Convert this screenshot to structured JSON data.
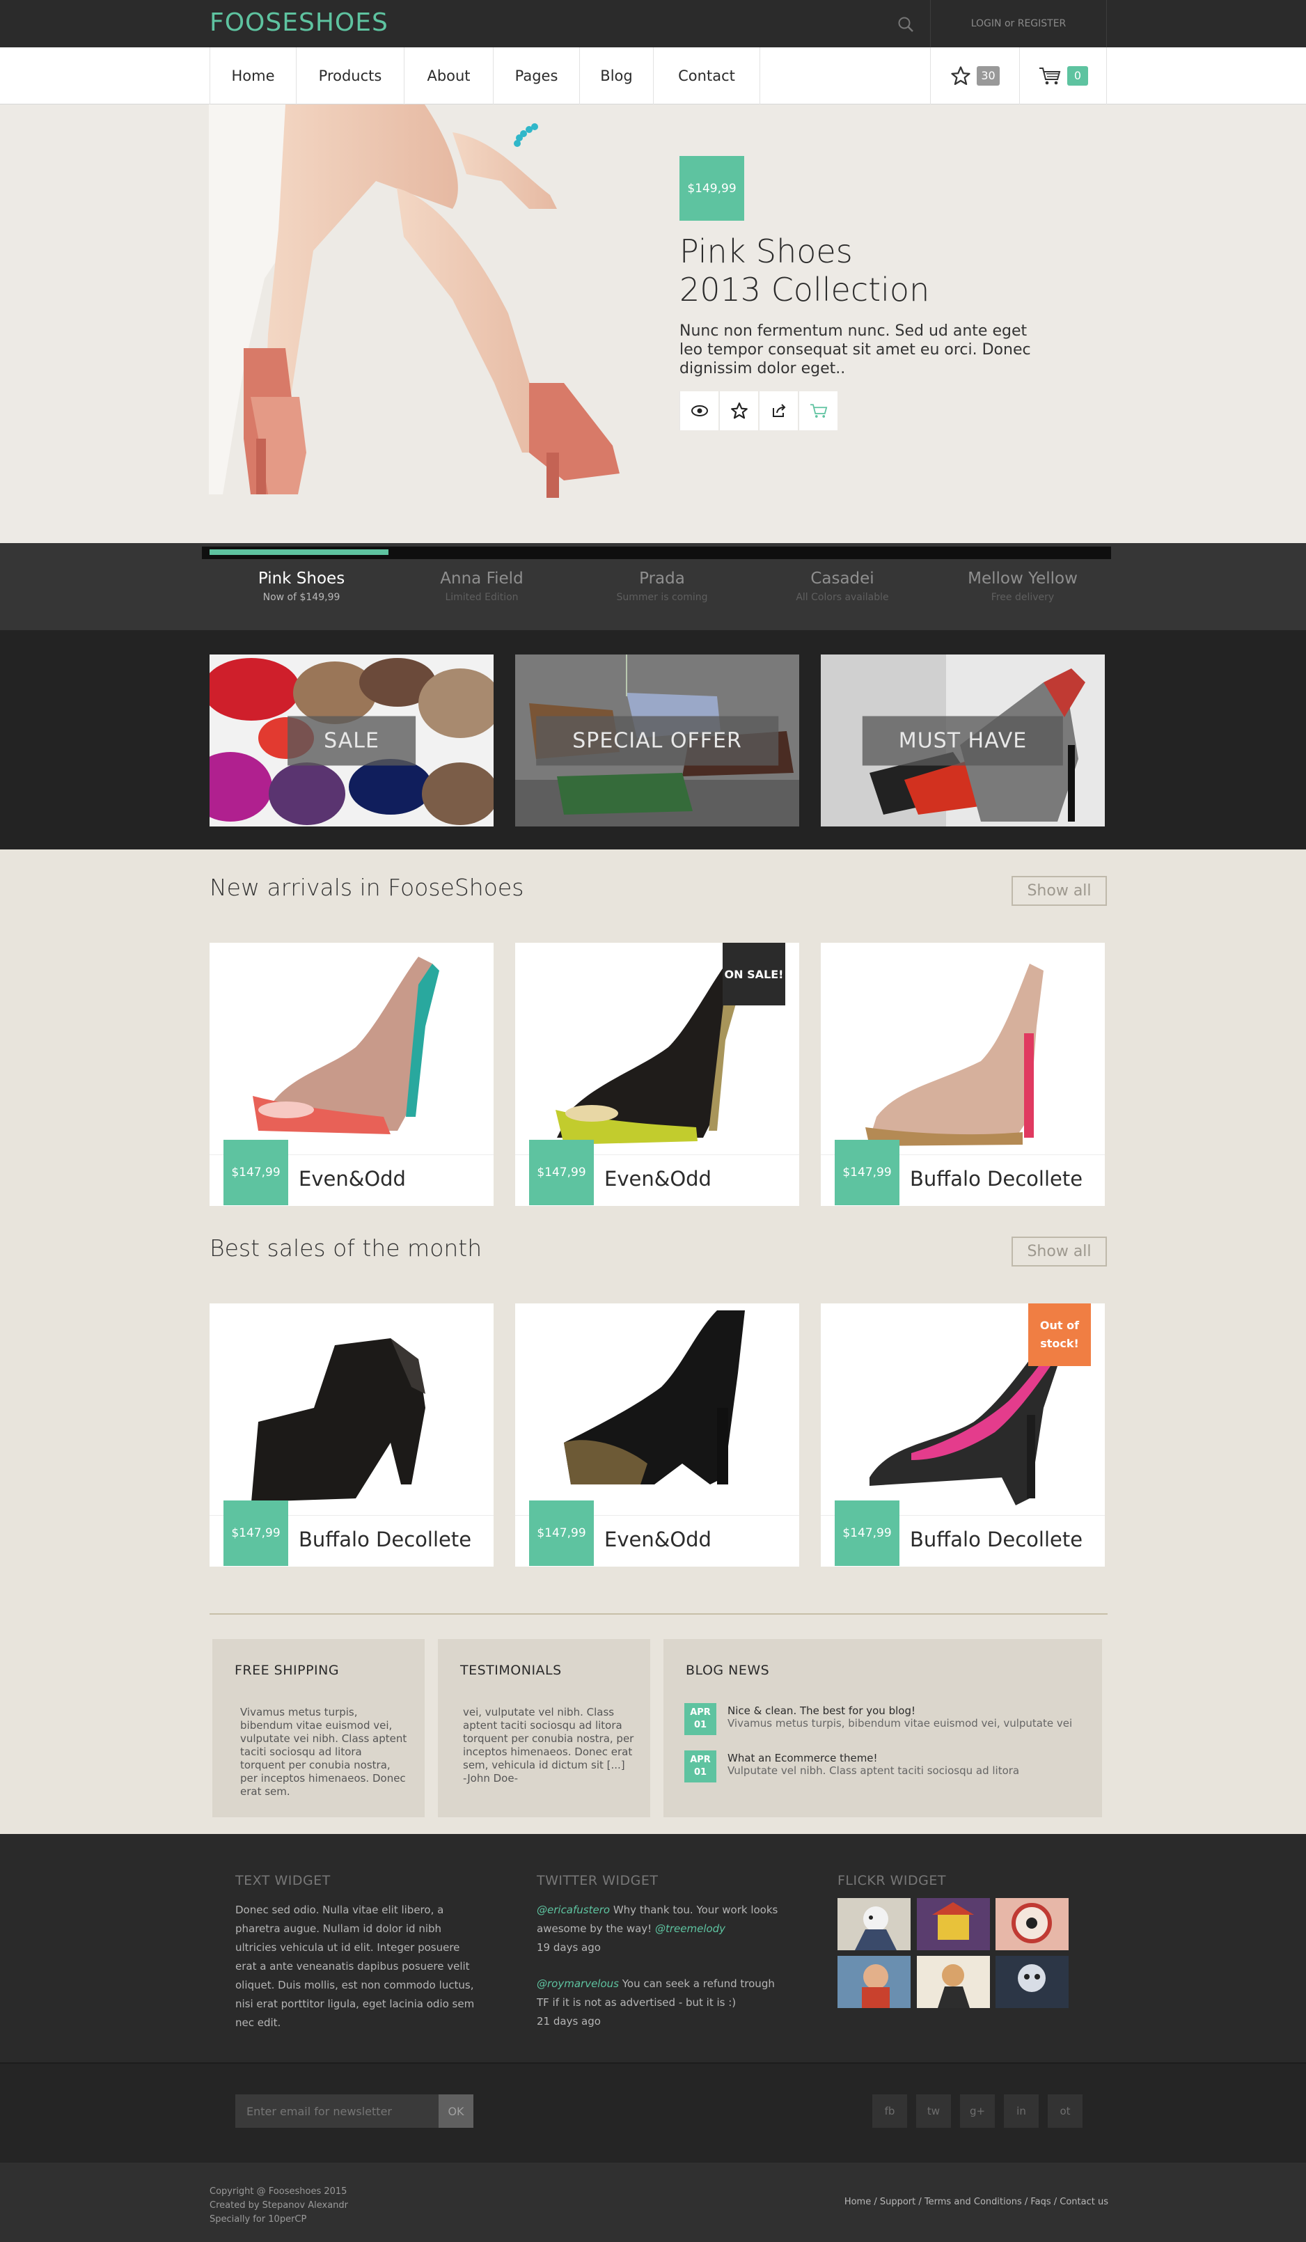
{
  "colors": {
    "accent": "#5ec3a0",
    "dark": "#2b2b2b",
    "page_bg": "#e8e4dc",
    "sale_orange": "#f07e43"
  },
  "header": {
    "logo": "FOOSESHOES",
    "login": "LOGIN or REGISTER",
    "wishlist_count": "30",
    "cart_count": "0"
  },
  "nav": {
    "items": [
      "Home",
      "Products",
      "About",
      "Pages",
      "Blog",
      "Contact"
    ]
  },
  "hero": {
    "price": "$149,99",
    "title": "Pink Shoes\n2013 Collection",
    "description": "Nunc non fermentum nunc. Sed ud ante eget leo tempor consequat sit amet eu orci. Donec dignissim dolor eget..",
    "actions": [
      "eye-icon",
      "star-icon",
      "share-icon",
      "cart-icon"
    ]
  },
  "slider": {
    "progress": 0.2,
    "tabs": [
      {
        "title": "Pink Shoes",
        "sub": "Now of $149,99"
      },
      {
        "title": "Anna Field",
        "sub": "Limited Edition"
      },
      {
        "title": "Prada",
        "sub": "Summer is coming"
      },
      {
        "title": "Casadei",
        "sub": "All Colors available"
      },
      {
        "title": "Mellow Yellow",
        "sub": "Free delivery"
      }
    ]
  },
  "promos": [
    "SALE",
    "SPECIAL OFFER",
    "MUST HAVE"
  ],
  "new_arrivals": {
    "title": "New arrivals in FooseShoes",
    "show_all": "Show all",
    "items": [
      {
        "price": "$147,99",
        "name": "Even&Odd",
        "badge": ""
      },
      {
        "price": "$147,99",
        "name": "Even&Odd",
        "badge": "ON SALE!"
      },
      {
        "price": "$147,99",
        "name": "Buffalo Decollete",
        "badge": ""
      }
    ]
  },
  "best_sales": {
    "title": "Best sales of the month",
    "show_all": "Show all",
    "items": [
      {
        "price": "$147,99",
        "name": "Buffalo Decollete",
        "badge": ""
      },
      {
        "price": "$147,99",
        "name": "Even&Odd",
        "badge": ""
      },
      {
        "price": "$147,99",
        "name": "Buffalo Decollete",
        "badge": "Out of stock!"
      }
    ]
  },
  "info": {
    "shipping": {
      "title": "FREE SHIPPING",
      "text": "Vivamus metus turpis, bibendum vitae euismod vei, vulputate vei nibh. Class aptent taciti sociosqu ad litora torquent per conubia nostra, per inceptos himenaeos. Donec erat sem."
    },
    "testimonials": {
      "title": "TESTIMONIALS",
      "text": "vei, vulputate vel nibh. Class aptent taciti sociosqu ad litora torquent per conubia nostra, per inceptos himenaeos. Donec erat sem, vehicula id dictum sit [...]",
      "author": "-John Doe-"
    },
    "blog": {
      "title": "BLOG NEWS",
      "items": [
        {
          "month": "APR",
          "day": "01",
          "title": "Nice & clean. The best for you blog!",
          "text": "Vivamus metus turpis, bibendum vitae euismod vei, vulputate vei"
        },
        {
          "month": "APR",
          "day": "01",
          "title": "What an Ecommerce theme!",
          "text": "Vulputate vel nibh. Class aptent taciti sociosqu ad litora"
        }
      ]
    }
  },
  "footer": {
    "text_widget": {
      "title": "TEXT WIDGET",
      "text": "Donec sed odio. Nulla vitae elit libero, a pharetra augue. Nullam id dolor id nibh ultricies vehicula ut id elit. Integer posuere erat a ante veneanatis dapibus posuere velit oliquet. Duis mollis, est non commodo luctus, nisi erat porttitor ligula, eget lacinia odio sem nec edit."
    },
    "twitter": {
      "title": "TWITTER WIDGET",
      "tweets": [
        {
          "user": "@ericafustero",
          "text": " Why thank tou. Your work looks awesome by the way! ",
          "mention": "@treemelody",
          "time": "19 days ago"
        },
        {
          "user": "@roymarvelous",
          "text": " You can seek a refund trough TF if it is not as advertised - but it is :)",
          "mention": "",
          "time": "21 days ago"
        }
      ]
    },
    "flickr": {
      "title": "FLICKR WIDGET"
    },
    "newsletter": {
      "placeholder": "Enter email for newsletter",
      "ok": "OK"
    },
    "social": [
      "fb",
      "tw",
      "g+",
      "in",
      "ot"
    ],
    "copyright": "Copyright @ Fooseshoes 2015\nCreated by Stepanov Alexandr\nSpecially for 10perCP",
    "links": "Home / Support / Terms and Conditions / Faqs / Contact us"
  }
}
